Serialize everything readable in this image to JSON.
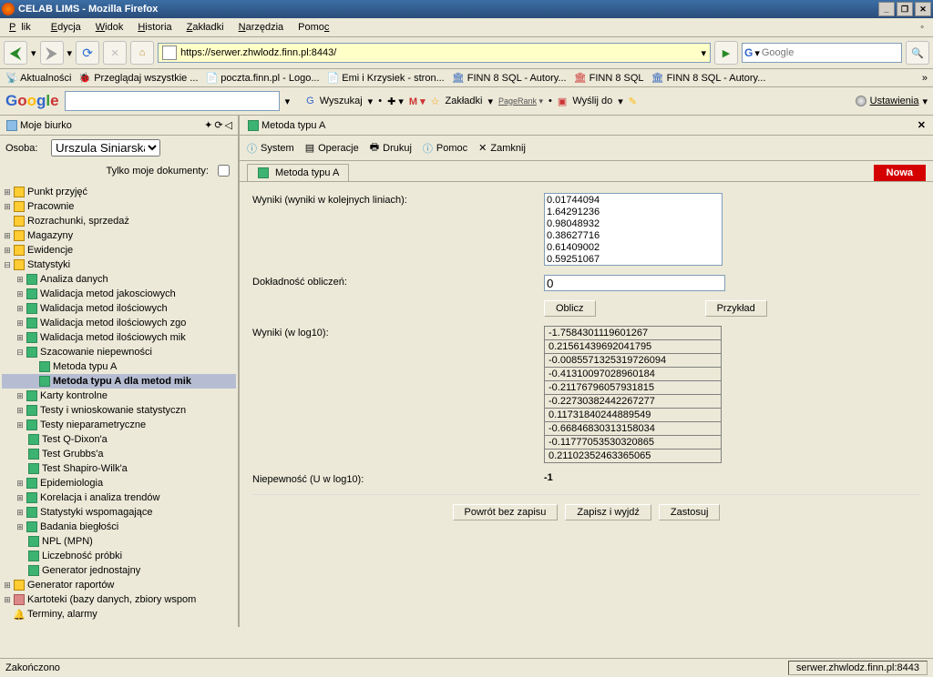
{
  "window": {
    "title": "CELAB LIMS - Mozilla Firefox"
  },
  "menu": {
    "plik": "Plik",
    "edycja": "Edycja",
    "widok": "Widok",
    "historia": "Historia",
    "zakladki": "Zakładki",
    "narzedzia": "Narzędzia",
    "pomoc": "Pomoc"
  },
  "url": "https://serwer.zhwlodz.finn.pl:8443/",
  "search_placeholder": "Google",
  "bookmarks": {
    "aktualnosci": "Aktualności",
    "przegladaj": "Przeglądaj wszystkie ...",
    "poczta": "poczta.finn.pl - Logo...",
    "emi": "Emi i Krzysiek - stron...",
    "finnsql1": "FINN 8 SQL - Autory...",
    "finnsql2": "FINN 8 SQL",
    "finnsql3": "FINN 8 SQL - Autory..."
  },
  "googlebar": {
    "wyszukaj": "Wyszukaj",
    "zakladki": "Zakładki",
    "pagerank": "PageRank",
    "wyslij": "Wyślij do",
    "ustawienia": "Ustawienia"
  },
  "sidebar": {
    "title": "Moje biurko",
    "osoba_label": "Osoba:",
    "osoba_value": "Urszula Siniarska",
    "tylko_moje": "Tylko moje dokumenty:",
    "items": {
      "punkt": "Punkt przyjęć",
      "pracownie": "Pracownie",
      "rozrachunki": "Rozrachunki, sprzedaż",
      "magazyny": "Magazyny",
      "ewidencje": "Ewidencje",
      "statystyki": "Statystyki",
      "analiza": "Analiza danych",
      "walidjak": "Walidacja metod jakosciowych",
      "walidilos": "Walidacja metod ilościowych",
      "walidilosz": "Walidacja metod ilościowych zgo",
      "walidilosm": "Walidacja metod ilościowych mik",
      "szacowanie": "Szacowanie niepewności",
      "metodaA": "Metoda typu A",
      "metodaAmik": "Metoda typu A dla metod mik",
      "karty": "Karty kontrolne",
      "testystat": "Testy i wnioskowanie statystyczn",
      "testynp": "Testy nieparametryczne",
      "dixon": "Test Q-Dixon'a",
      "grubbs": "Test Grubbs'a",
      "shapiro": "Test Shapiro-Wilk'a",
      "epi": "Epidemiologia",
      "korelacja": "Korelacja i analiza trendów",
      "statwsp": "Statystyki wspomagające",
      "badania": "Badania biegłości",
      "npl": "NPL (MPN)",
      "liczebnosc": "Liczebność próbki",
      "generator": "Generator jednostajny",
      "generatorr": "Generator raportów",
      "kartoteki": "Kartoteki (bazy danych, zbiory wspom",
      "terminy": "Terminy, alarmy"
    }
  },
  "content": {
    "title": "Metoda typu A",
    "menu": {
      "system": "System",
      "operacje": "Operacje",
      "drukuj": "Drukuj",
      "pomoc": "Pomoc",
      "zamknij": "Zamknij"
    },
    "tab": "Metoda typu A",
    "nowa": "Nowa",
    "labels": {
      "wyniki": "Wyniki (wyniki w kolejnych liniach):",
      "dokladnosc": "Dokładność obliczeń:",
      "wynikilog": "Wyniki (w log10):",
      "niepewnosc": "Niepewność (U w log10):"
    },
    "wyniki_text": "0.01744094\n1.64291236\n0.98048932\n0.38627716\n0.61409002\n0.59251067",
    "dokladnosc": "0",
    "oblicz": "Oblicz",
    "przyklad": "Przykład",
    "log10": [
      "-1.7584301119601267",
      "0.21561439692041795",
      "-0.0085571325319726094",
      "-0.41310097028960184",
      "-0.21176796057931815",
      "-0.22730382442267277",
      "0.11731840244889549",
      "-0.66846830313158034",
      "-0.11777053530320865",
      "0.21102352463365065"
    ],
    "niepewnosc": "-1",
    "buttons": {
      "powrot": "Powrót bez zapisu",
      "zapisz": "Zapisz i wyjdź",
      "zastosuj": "Zastosuj"
    }
  },
  "status": {
    "left": "Zakończono",
    "right": "serwer.zhwlodz.finn.pl:8443"
  }
}
